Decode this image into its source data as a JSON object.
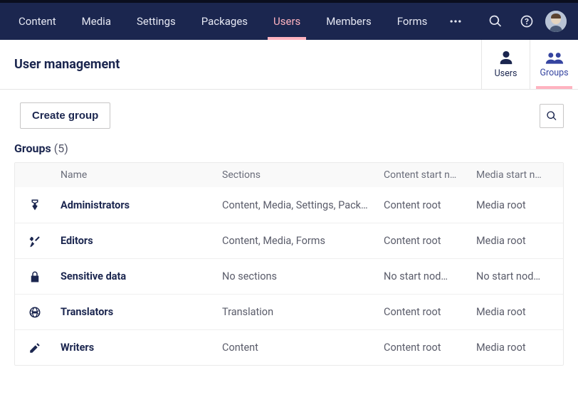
{
  "nav": {
    "items": [
      {
        "label": "Content"
      },
      {
        "label": "Media"
      },
      {
        "label": "Settings"
      },
      {
        "label": "Packages"
      },
      {
        "label": "Users",
        "active": true
      },
      {
        "label": "Members"
      },
      {
        "label": "Forms"
      }
    ]
  },
  "header": {
    "title": "User management",
    "views": {
      "users": "Users",
      "groups": "Groups",
      "activeView": "Groups"
    }
  },
  "toolbar": {
    "createGroupLabel": "Create group"
  },
  "section": {
    "label": "Groups",
    "count": "(5)"
  },
  "table": {
    "headers": {
      "name": "Name",
      "sections": "Sections",
      "contentStart": "Content start n…",
      "mediaStart": "Media start n…"
    },
    "rows": [
      {
        "icon": "badge-icon",
        "name": "Administrators",
        "sections": "Content, Media, Settings, Packa…",
        "contentStart": "Content root",
        "mediaStart": "Media root"
      },
      {
        "icon": "tools-icon",
        "name": "Editors",
        "sections": "Content, Media, Forms",
        "contentStart": "Content root",
        "mediaStart": "Media root"
      },
      {
        "icon": "lock-icon",
        "name": "Sensitive data",
        "sections": "No sections",
        "contentStart": "No start nod…",
        "mediaStart": "No start nod…"
      },
      {
        "icon": "globe-icon",
        "name": "Translators",
        "sections": "Translation",
        "contentStart": "Content root",
        "mediaStart": "Media root"
      },
      {
        "icon": "pencil-icon",
        "name": "Writers",
        "sections": "Content",
        "contentStart": "Content root",
        "mediaStart": "Media root"
      }
    ]
  }
}
